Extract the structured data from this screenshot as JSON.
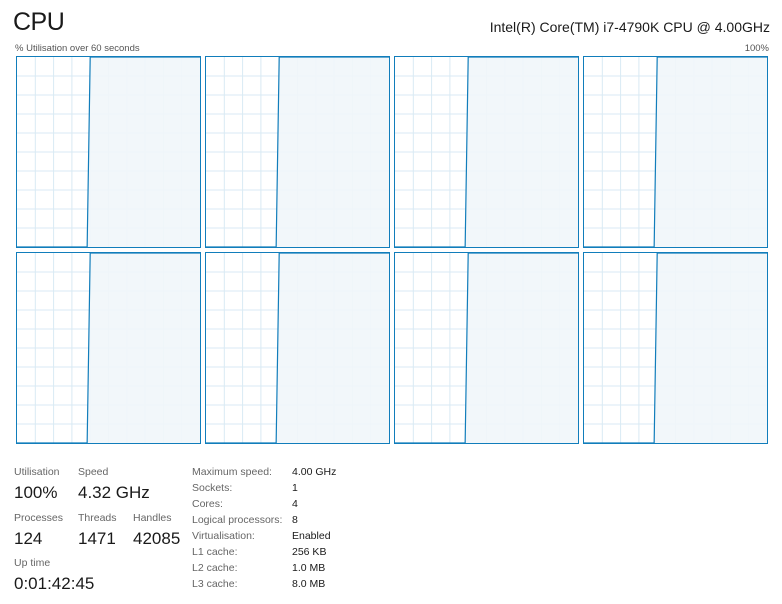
{
  "header": {
    "title": "CPU",
    "cpu_model": "Intel(R) Core(TM) i7-4790K CPU @ 4.00GHz",
    "axis_left": "% Utilisation over 60 seconds",
    "axis_right": "100%"
  },
  "colors": {
    "graph_line": "#117dbb",
    "graph_fill": "#f1f6fa",
    "grid": "#d9eaf4"
  },
  "core_graphs": [
    {
      "samples": [
        0,
        0,
        0,
        0,
        0,
        0,
        0,
        0,
        0,
        0,
        0,
        0,
        0,
        0,
        0,
        0,
        0,
        0,
        0,
        0,
        0,
        0,
        0,
        0,
        100,
        100,
        100,
        100,
        100,
        100,
        100,
        100,
        100,
        100,
        100,
        100,
        100,
        100,
        100,
        100,
        100,
        100,
        100,
        100,
        100,
        100,
        100,
        100,
        100,
        100,
        100,
        100,
        100,
        100,
        100,
        100,
        100,
        100,
        100,
        100,
        100
      ]
    },
    {
      "samples": [
        0,
        0,
        0,
        0,
        0,
        0,
        0,
        0,
        0,
        0,
        0,
        0,
        0,
        0,
        0,
        0,
        0,
        0,
        0,
        0,
        0,
        0,
        0,
        0,
        100,
        100,
        100,
        100,
        100,
        100,
        100,
        100,
        100,
        100,
        100,
        100,
        100,
        100,
        100,
        100,
        100,
        100,
        100,
        100,
        100,
        100,
        100,
        100,
        100,
        100,
        100,
        100,
        100,
        100,
        100,
        100,
        100,
        100,
        100,
        100,
        100
      ]
    },
    {
      "samples": [
        0,
        0,
        0,
        0,
        0,
        0,
        0,
        0,
        0,
        0,
        0,
        0,
        0,
        0,
        0,
        0,
        0,
        0,
        0,
        0,
        0,
        0,
        0,
        0,
        100,
        100,
        100,
        100,
        100,
        100,
        100,
        100,
        100,
        100,
        100,
        100,
        100,
        100,
        100,
        100,
        100,
        100,
        100,
        100,
        100,
        100,
        100,
        100,
        100,
        100,
        100,
        100,
        100,
        100,
        100,
        100,
        100,
        100,
        100,
        100,
        100
      ]
    },
    {
      "samples": [
        0,
        0,
        0,
        0,
        0,
        0,
        0,
        0,
        0,
        0,
        0,
        0,
        0,
        0,
        0,
        0,
        0,
        0,
        0,
        0,
        0,
        0,
        0,
        0,
        100,
        100,
        100,
        100,
        100,
        100,
        100,
        100,
        100,
        100,
        100,
        100,
        100,
        100,
        100,
        100,
        100,
        100,
        100,
        100,
        100,
        100,
        100,
        100,
        100,
        100,
        100,
        100,
        100,
        100,
        100,
        100,
        100,
        100,
        100,
        100,
        100
      ]
    },
    {
      "samples": [
        0,
        0,
        0,
        0,
        0,
        0,
        0,
        0,
        0,
        0,
        0,
        0,
        0,
        0,
        0,
        0,
        0,
        0,
        0,
        0,
        0,
        0,
        0,
        0,
        100,
        100,
        100,
        100,
        100,
        100,
        100,
        100,
        100,
        100,
        100,
        100,
        100,
        100,
        100,
        100,
        100,
        100,
        100,
        100,
        100,
        100,
        100,
        100,
        100,
        100,
        100,
        100,
        100,
        100,
        100,
        100,
        100,
        100,
        100,
        100,
        100
      ]
    },
    {
      "samples": [
        0,
        0,
        0,
        0,
        0,
        0,
        0,
        0,
        0,
        0,
        0,
        0,
        0,
        0,
        0,
        0,
        0,
        0,
        0,
        0,
        0,
        0,
        0,
        0,
        100,
        100,
        100,
        100,
        100,
        100,
        100,
        100,
        100,
        100,
        100,
        100,
        100,
        100,
        100,
        100,
        100,
        100,
        100,
        100,
        100,
        100,
        100,
        100,
        100,
        100,
        100,
        100,
        100,
        100,
        100,
        100,
        100,
        100,
        100,
        100,
        100
      ]
    },
    {
      "samples": [
        0,
        0,
        0,
        0,
        0,
        0,
        0,
        0,
        0,
        0,
        0,
        0,
        0,
        0,
        0,
        0,
        0,
        0,
        0,
        0,
        0,
        0,
        0,
        0,
        100,
        100,
        100,
        100,
        100,
        100,
        100,
        100,
        100,
        100,
        100,
        100,
        100,
        100,
        100,
        100,
        100,
        100,
        100,
        100,
        100,
        100,
        100,
        100,
        100,
        100,
        100,
        100,
        100,
        100,
        100,
        100,
        100,
        100,
        100,
        100,
        100
      ]
    },
    {
      "samples": [
        0,
        0,
        0,
        0,
        0,
        0,
        0,
        0,
        0,
        0,
        0,
        0,
        0,
        0,
        0,
        0,
        0,
        0,
        0,
        0,
        0,
        0,
        0,
        0,
        100,
        100,
        100,
        100,
        100,
        100,
        100,
        100,
        100,
        100,
        100,
        100,
        100,
        100,
        100,
        100,
        100,
        100,
        100,
        100,
        100,
        100,
        100,
        100,
        100,
        100,
        100,
        100,
        100,
        100,
        100,
        100,
        100,
        100,
        100,
        100,
        100
      ]
    }
  ],
  "stats": {
    "utilisation_label": "Utilisation",
    "utilisation_value": "100%",
    "speed_label": "Speed",
    "speed_value": "4.32 GHz",
    "processes_label": "Processes",
    "processes_value": "124",
    "threads_label": "Threads",
    "threads_value": "1471",
    "handles_label": "Handles",
    "handles_value": "42085",
    "uptime_label": "Up time",
    "uptime_value": "0:01:42:45"
  },
  "specs": [
    {
      "label": "Maximum speed:",
      "value": "4.00 GHz"
    },
    {
      "label": "Sockets:",
      "value": "1"
    },
    {
      "label": "Cores:",
      "value": "4"
    },
    {
      "label": "Logical processors:",
      "value": "8"
    },
    {
      "label": "Virtualisation:",
      "value": "Enabled"
    },
    {
      "label": "L1 cache:",
      "value": "256 KB"
    },
    {
      "label": "L2 cache:",
      "value": "1.0 MB"
    },
    {
      "label": "L3 cache:",
      "value": "8.0 MB"
    }
  ]
}
